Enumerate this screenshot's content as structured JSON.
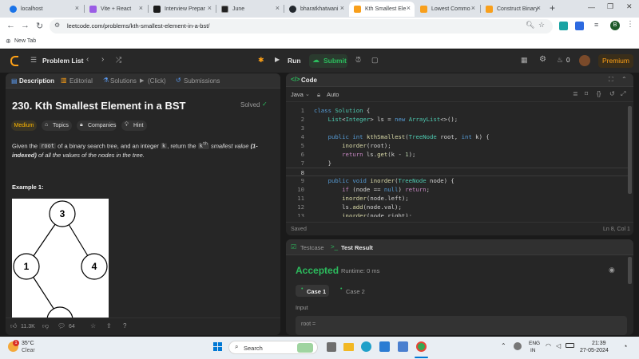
{
  "browser": {
    "tabs": [
      {
        "title": "localhost",
        "color": "#1a73e8"
      },
      {
        "title": "Vite + React",
        "color": "#9b5de5"
      },
      {
        "title": "Interview Prepar",
        "color": "#1c1c1c"
      },
      {
        "title": "June",
        "color": "#222222"
      },
      {
        "title": "bharatkhatwani",
        "color": "#24292e"
      },
      {
        "title": "Kth Smallest Ele",
        "color": "#f89f1b"
      },
      {
        "title": "Lowest Commo",
        "color": "#f89f1b"
      },
      {
        "title": "Construct Binary",
        "color": "#f89f1b"
      }
    ],
    "new_tab": "+",
    "url": "leetcode.com/problems/kth-smallest-element-in-a-bst/",
    "bookmark": "New Tab",
    "profile_initial": "B"
  },
  "nav": {
    "problem_list": "Problem List",
    "run": "Run",
    "submit": "Submit",
    "streak": "0",
    "premium": "Premium"
  },
  "left_tabs": {
    "description": "Description",
    "editorial": "Editorial",
    "solutions": "Solutions",
    "click": "(Click)",
    "submissions": "Submissions"
  },
  "problem": {
    "title": "230. Kth Smallest Element in a BST",
    "status": "Solved",
    "difficulty": "Medium",
    "topics": "Topics",
    "companies": "Companies",
    "hint": "Hint",
    "desc_1": "Given the",
    "desc_root": "root",
    "desc_2": "of a binary search tree, and an integer",
    "desc_k": "k",
    "desc_3": ", return the",
    "desc_kth": "k",
    "desc_th": "th",
    "desc_4": "smallest value",
    "desc_5": "(1-",
    "desc_6": "indexed)",
    "desc_7": "of all the values of the nodes in the tree.",
    "example_label": "Example 1:",
    "tree_nodes": [
      "3",
      "1",
      "4"
    ],
    "likes": "11.3K",
    "comments": "64"
  },
  "code": {
    "header": "Code",
    "language": "Java",
    "mode": "Auto",
    "saved": "Saved",
    "cursor": "Ln 8, Col 1",
    "line_numbers": [
      "1",
      "2",
      "3",
      "4",
      "5",
      "6",
      "7",
      "8",
      "9",
      "10",
      "11",
      "12",
      "13"
    ]
  },
  "result": {
    "testcase_tab": "Testcase",
    "result_tab": "Test Result",
    "status": "Accepted",
    "runtime": "Runtime: 0 ms",
    "case1": "Case 1",
    "case2": "Case 2",
    "input_label": "Input",
    "input_var": "root ="
  },
  "taskbar": {
    "temp": "35°C",
    "weather": "Clear",
    "search": "Search",
    "lang1": "ENG",
    "lang2": "IN",
    "time": "21:39",
    "date": "27-05-2024",
    "weather_badge": "1"
  }
}
